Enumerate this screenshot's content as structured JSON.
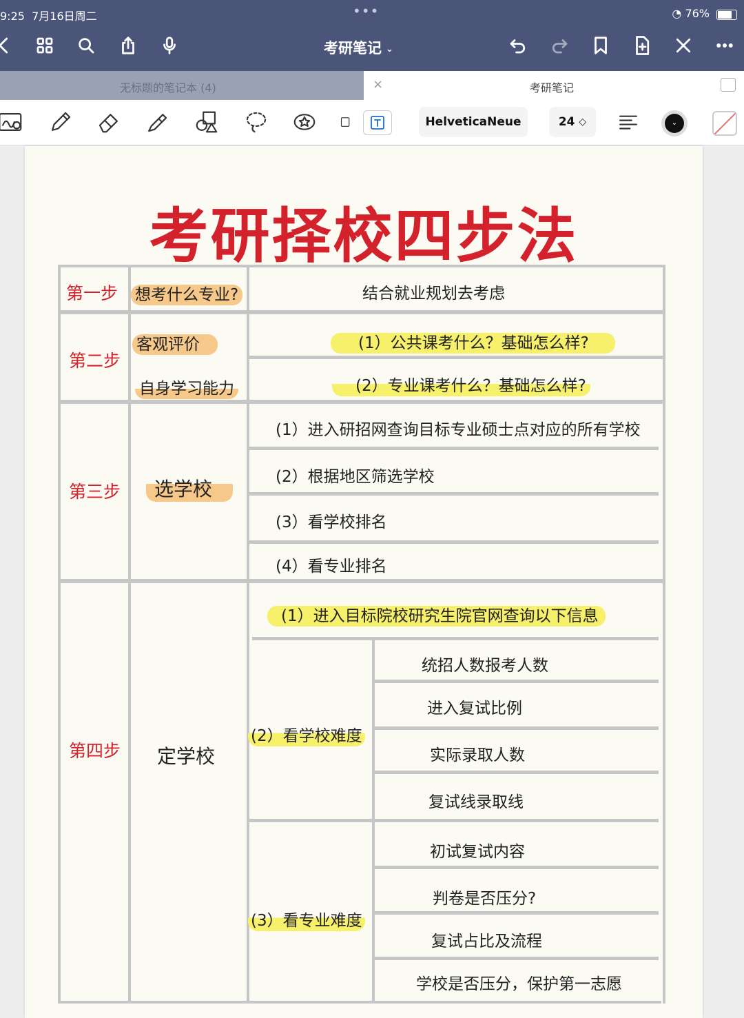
{
  "status_bar": {
    "time": "9:25",
    "date": "7月16日周二",
    "dots": "•••",
    "battery": "76%"
  },
  "app": {
    "title": "考研笔记",
    "title_chevron": "⌄"
  },
  "tabs": [
    {
      "label": "无标题的笔记本 (4)",
      "active": false
    },
    {
      "label": "考研笔记",
      "active": true
    }
  ],
  "tab_close": "×",
  "toolbar": {
    "font": "HelveticaNeue",
    "size": "24",
    "size_arrows": "◇"
  },
  "note": {
    "title": "考研择校四步法",
    "step1": {
      "label": "第一步",
      "question": "想考什么专业?",
      "detail": "结合就业规划去考虑"
    },
    "step2": {
      "label": "第二步",
      "left_top": "客观评价",
      "left_bottom": "自身学习能力",
      "items": [
        "(1）公共课考什么？基础怎么样?",
        "(2）专业课考什么？基础怎么样?"
      ]
    },
    "step3": {
      "label": "第三步",
      "middle": "选学校",
      "items": [
        "(1）进入研招网查询目标专业硕士点对应的所有学校",
        "(2）根据地区筛选学校",
        "(3）看学校排名",
        "(4）看专业排名"
      ]
    },
    "step4": {
      "label": "第四步",
      "middle": "定学校",
      "top": "(1）进入目标院校研究生院官网查询以下信息",
      "sub2": {
        "label": "(2）看学校难度",
        "items": [
          "统招人数报考人数",
          "进入复试比例",
          "实际录取人数",
          "复试线录取线"
        ]
      },
      "sub3": {
        "label": "(3）看专业难度",
        "items": [
          "初试复试内容",
          "判卷是否压分?",
          "复试占比及流程",
          "学校是否压分，保护第一志愿"
        ]
      }
    }
  }
}
